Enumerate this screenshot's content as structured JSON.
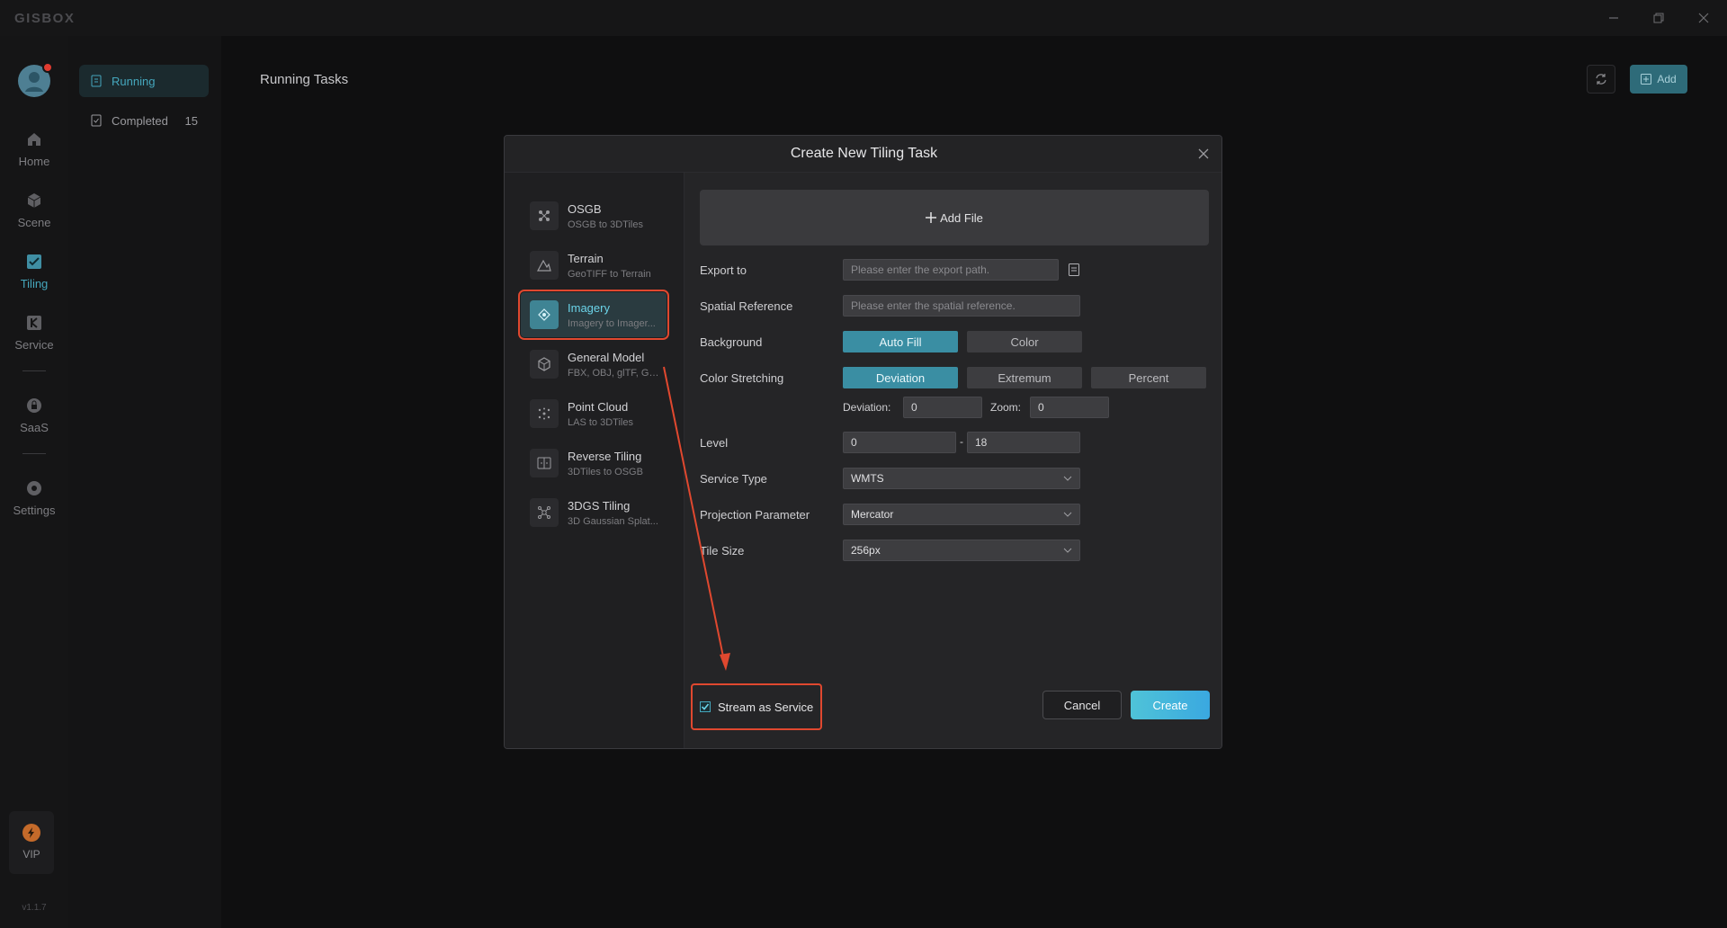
{
  "app": {
    "brand": "GISBOX",
    "version": "v1.1.7"
  },
  "nav": {
    "items": [
      {
        "label": "Home",
        "icon": "home-icon"
      },
      {
        "label": "Scene",
        "icon": "cube-icon"
      },
      {
        "label": "Tiling",
        "icon": "tiling-icon"
      },
      {
        "label": "Service",
        "icon": "service-icon"
      },
      {
        "label": "SaaS",
        "icon": "lock-icon"
      },
      {
        "label": "Settings",
        "icon": "gear-icon"
      }
    ],
    "active": "Tiling",
    "vip_label": "VIP"
  },
  "subnav": {
    "running_label": "Running",
    "completed_label": "Completed",
    "completed_count": "15"
  },
  "main": {
    "title": "Running Tasks",
    "add_label": "Add"
  },
  "modal": {
    "title": "Create New Tiling Task",
    "types": [
      {
        "name": "OSGB",
        "sub": "OSGB to 3DTiles",
        "icon": "osgb-icon"
      },
      {
        "name": "Terrain",
        "sub": "GeoTIFF to Terrain",
        "icon": "terrain-icon"
      },
      {
        "name": "Imagery",
        "sub": "Imagery to Imager...",
        "icon": "imagery-icon"
      },
      {
        "name": "General Model",
        "sub": "FBX, OBJ, glTF, GL...",
        "icon": "model-icon"
      },
      {
        "name": "Point Cloud",
        "sub": "LAS to 3DTiles",
        "icon": "point-cloud-icon"
      },
      {
        "name": "Reverse Tiling",
        "sub": "3DTiles to OSGB",
        "icon": "reverse-icon"
      },
      {
        "name": "3DGS Tiling",
        "sub": "3D Gaussian Splat...",
        "icon": "gaussian-icon"
      }
    ],
    "selected_type": "Imagery",
    "form": {
      "add_file_label": "Add File",
      "export_label": "Export to",
      "export_placeholder": "Please enter the export path.",
      "spatial_label": "Spatial Reference",
      "spatial_placeholder": "Please enter the spatial reference.",
      "background_label": "Background",
      "background_options": [
        "Auto Fill",
        "Color"
      ],
      "background_selected": "Auto Fill",
      "stretch_label": "Color Stretching",
      "stretch_options": [
        "Deviation",
        "Extremum",
        "Percent"
      ],
      "stretch_selected": "Deviation",
      "deviation_label": "Deviation:",
      "deviation_value": "0",
      "zoom_label": "Zoom:",
      "zoom_value": "0",
      "level_label": "Level",
      "level_min": "0",
      "level_sep": "-",
      "level_max": "18",
      "service_type_label": "Service Type",
      "service_type_value": "WMTS",
      "projection_label": "Projection Parameter",
      "projection_value": "Mercator",
      "tile_size_label": "Tile Size",
      "tile_size_value": "256px"
    },
    "stream_label": "Stream as Service",
    "stream_checked": true,
    "cancel_label": "Cancel",
    "create_label": "Create"
  },
  "colors": {
    "accent": "#3a8ea3",
    "highlight": "#e0482f",
    "create_gradient_start": "#4fc3d8",
    "create_gradient_end": "#3aa8e0"
  }
}
